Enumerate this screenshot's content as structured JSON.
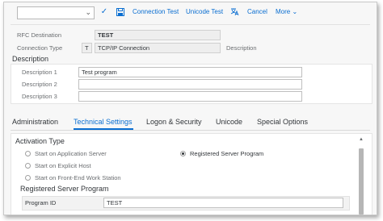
{
  "toolbar": {
    "select_value": "",
    "connection_test": "Connection Test",
    "unicode_test": "Unicode Test",
    "cancel": "Cancel",
    "more": "More",
    "icons": [
      "chevron-down-icon",
      "checkmark-icon",
      "save-icon",
      "translate-icon",
      "chevron-down-icon"
    ]
  },
  "header": {
    "rfc_destination_label": "RFC Destination",
    "rfc_destination_value": "TEST",
    "connection_type_label": "Connection Type",
    "connection_type_code": "T",
    "connection_type_value": "TCP/IP Connection",
    "description_label": "Description"
  },
  "description": {
    "title": "Description",
    "rows": [
      {
        "label": "Description 1",
        "value": "Test program"
      },
      {
        "label": "Description 2",
        "value": ""
      },
      {
        "label": "Description 3",
        "value": ""
      }
    ]
  },
  "tabs": [
    {
      "label": "Administration",
      "active": false
    },
    {
      "label": "Technical Settings",
      "active": true
    },
    {
      "label": "Logon & Security",
      "active": false
    },
    {
      "label": "Unicode",
      "active": false
    },
    {
      "label": "Special Options",
      "active": false
    }
  ],
  "technical": {
    "activation_title": "Activation Type",
    "options": [
      {
        "label": "Start on Application Server",
        "selected": false
      },
      {
        "label": "Registered Server Program",
        "selected": true
      },
      {
        "label": "Start on Explicit Host",
        "selected": false
      },
      {
        "label": "Start on Front-End Work Station",
        "selected": false
      }
    ],
    "registered_title": "Registered Server Program",
    "program_id_label": "Program ID",
    "program_id_value": "TEST"
  },
  "colors": {
    "accent": "#0a6ed1",
    "text": "#32363a",
    "label": "#6a6d70"
  }
}
